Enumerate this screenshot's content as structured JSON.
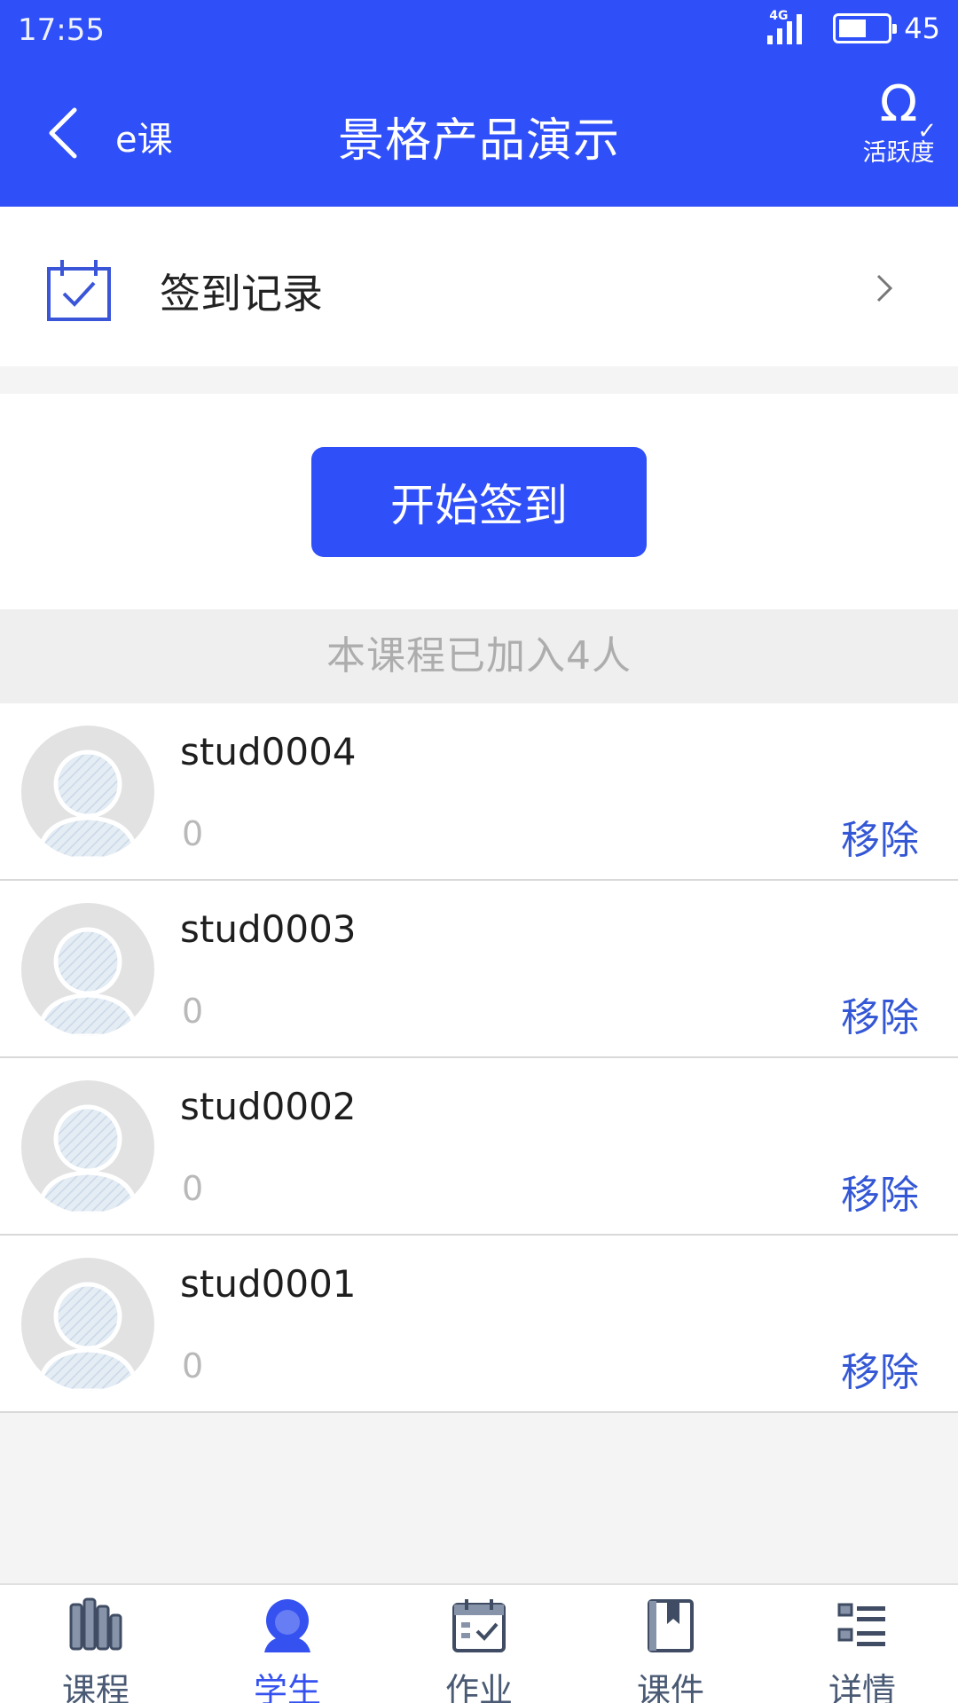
{
  "status_bar": {
    "time": "17:55",
    "network": "4G",
    "battery": "45"
  },
  "nav": {
    "back_label": "e课",
    "title": "景格产品演示",
    "activity_label": "活跃度"
  },
  "records": {
    "label": "签到记录"
  },
  "start_button": {
    "label": "开始签到"
  },
  "count_text": "本课程已加入4人",
  "students": [
    {
      "name": "stud0004",
      "score": "0",
      "action": "移除"
    },
    {
      "name": "stud0003",
      "score": "0",
      "action": "移除"
    },
    {
      "name": "stud0002",
      "score": "0",
      "action": "移除"
    },
    {
      "name": "stud0001",
      "score": "0",
      "action": "移除"
    }
  ],
  "tabs": [
    {
      "label": "课程",
      "icon": "books-icon",
      "active": false
    },
    {
      "label": "学生",
      "icon": "student-icon",
      "active": true
    },
    {
      "label": "作业",
      "icon": "homework-calendar-icon",
      "active": false
    },
    {
      "label": "课件",
      "icon": "courseware-icon",
      "active": false
    },
    {
      "label": "详情",
      "icon": "details-list-icon",
      "active": false
    }
  ],
  "colors": {
    "primary": "#2f4ff8",
    "remove_text": "#3457d5",
    "active_tab": "#3552f0",
    "inactive_tab": "#4a5a74"
  }
}
